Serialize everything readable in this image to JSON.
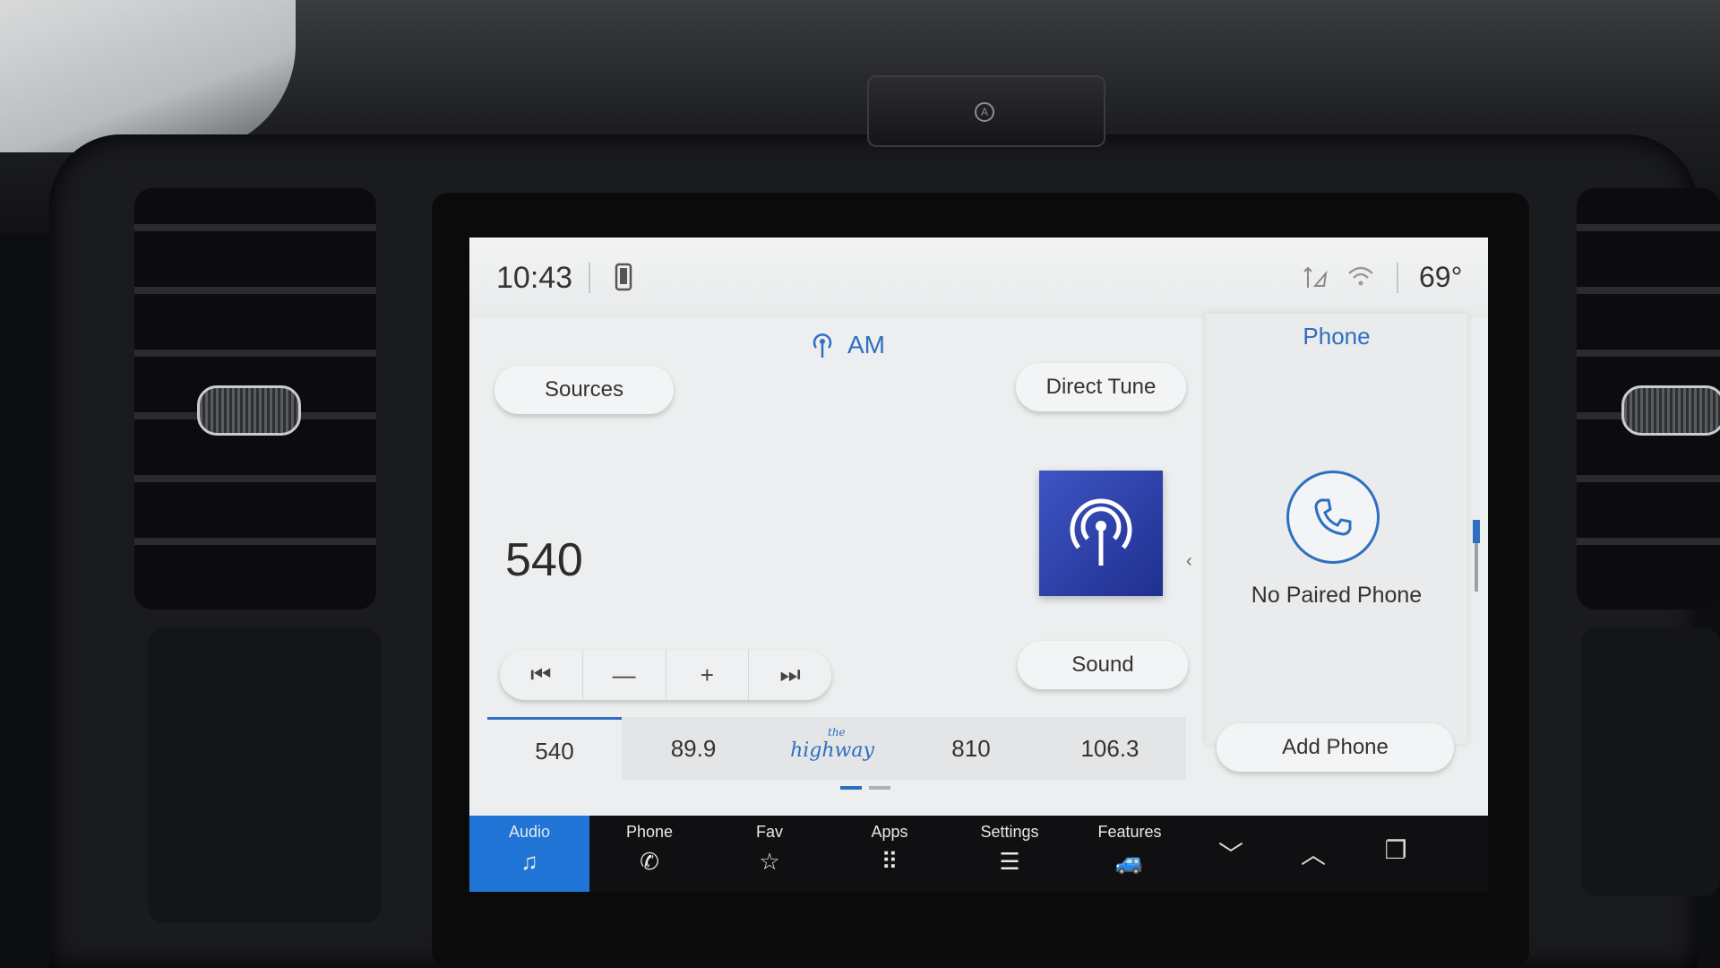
{
  "status_bar": {
    "time": "10:43",
    "temperature": "69°",
    "icons": [
      "phone-projection-icon",
      "gps-signal-icon",
      "wifi-icon"
    ]
  },
  "audio": {
    "source_icon": "antenna-icon",
    "source_label": "AM",
    "sources_label": "Sources",
    "direct_tune_label": "Direct Tune",
    "sound_label": "Sound",
    "frequency": "540",
    "transport": [
      {
        "name": "seek-back",
        "icon": "⏮"
      },
      {
        "name": "tune-down",
        "icon": "—"
      },
      {
        "name": "tune-up",
        "icon": "+"
      },
      {
        "name": "seek-forward",
        "icon": "⏭"
      }
    ],
    "presets": [
      "540",
      "89.9",
      "highway",
      "810",
      "106.3"
    ],
    "preset_logo_small": "the",
    "active_preset_index": 0,
    "page_indicator": {
      "pages": 2,
      "active": 0
    }
  },
  "phone_card": {
    "title": "Phone",
    "status": "No Paired Phone",
    "add_label": "Add Phone"
  },
  "nav": {
    "items": [
      {
        "label": "Audio",
        "icon": "♫"
      },
      {
        "label": "Phone",
        "icon": "✆"
      },
      {
        "label": "Fav",
        "icon": "☆"
      },
      {
        "label": "Apps",
        "icon": "⠿"
      },
      {
        "label": "Settings",
        "icon": "☰"
      },
      {
        "label": "Features",
        "icon": "🚙"
      }
    ],
    "active_index": 0
  },
  "colors": {
    "accent": "#2f6fbf",
    "nav_active": "#1f74d6",
    "art_tile": "#2d3fae"
  }
}
